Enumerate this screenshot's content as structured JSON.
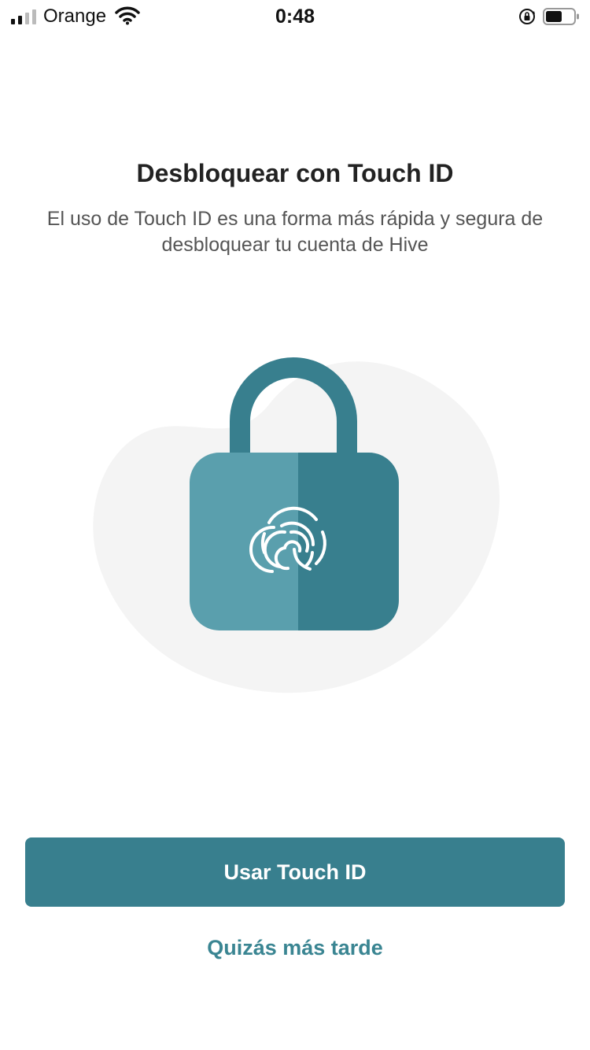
{
  "status_bar": {
    "carrier": "Orange",
    "time": "0:48",
    "signal_icon": "signal-bars-icon",
    "wifi_icon": "wifi-icon",
    "rotation_lock_icon": "rotation-lock-icon",
    "battery_icon": "battery-icon"
  },
  "main": {
    "title": "Desbloquear con Touch ID",
    "description": "El uso de Touch ID es una forma más rápida y segura de desbloquear tu cuenta de Hive",
    "illustration_icon": "fingerprint-lock-icon"
  },
  "actions": {
    "primary_label": "Usar Touch ID",
    "secondary_label": "Quizás más tarde"
  },
  "colors": {
    "accent": "#387f8e",
    "lock_light": "#5a9fad",
    "lock_dark": "#387f8e",
    "link": "#3a8592",
    "blob": "#f4f4f4"
  }
}
